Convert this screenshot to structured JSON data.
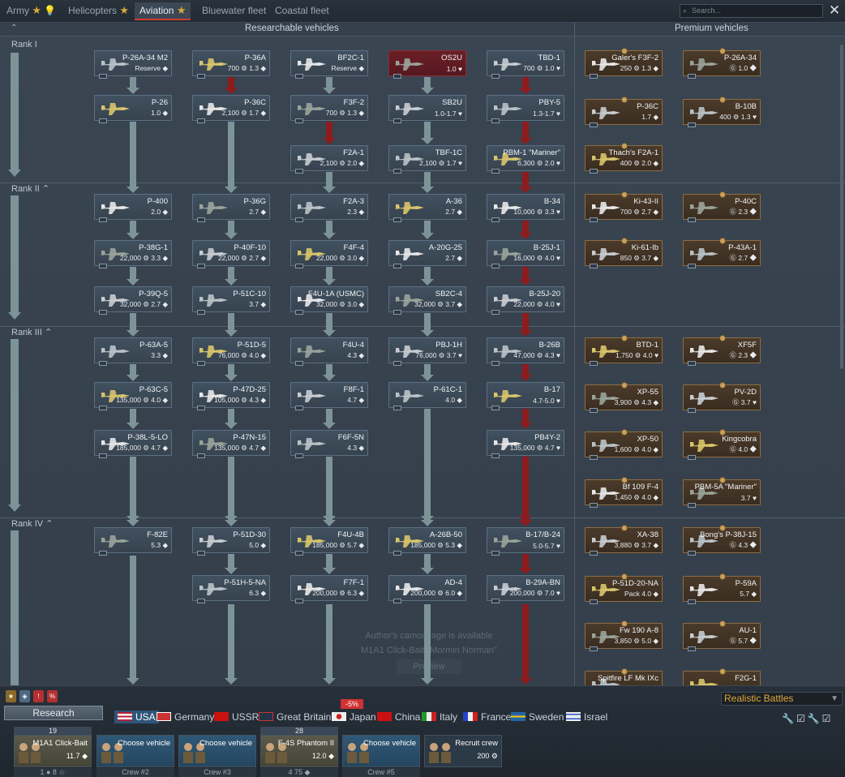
{
  "tabs": [
    {
      "label": "Army",
      "active": false
    },
    {
      "label": "Helicopters",
      "active": false
    },
    {
      "label": "Aviation",
      "active": true
    },
    {
      "label": "Bluewater fleet",
      "active": false
    },
    {
      "label": "Coastal fleet",
      "active": false
    }
  ],
  "search": {
    "placeholder": "Search..."
  },
  "headers": {
    "researchable": "Researchable vehicles",
    "premium": "Premium vehicles"
  },
  "ranks": [
    "Rank I",
    "Rank II",
    "Rank III",
    "Rank IV"
  ],
  "tree": {
    "col1": [
      {
        "name": "P-26A-34 M2",
        "info": "Reserve ◆"
      },
      {
        "name": "P-26",
        "info": "1.0 ◆"
      },
      {
        "name": "P-400",
        "info": "2.0 ◆"
      },
      {
        "name": "P-38G-1",
        "info": "22,000 ⚙ 3.3 ◆"
      },
      {
        "name": "P-39Q-5",
        "info": "32,000 ⚙ 2.7 ◆"
      },
      {
        "name": "P-63A-5",
        "info": "3.3 ◆"
      },
      {
        "name": "P-63C-5",
        "info": "135,000 ⚙ 4.0 ◆"
      },
      {
        "name": "P-38L-5-LO",
        "info": "185,000 ⚙ 4.7 ◆"
      },
      {
        "name": "F-82E",
        "info": "5.3 ◆"
      }
    ],
    "col2": [
      {
        "name": "P-36A",
        "info": "700 ⚙ 1.3 ◆"
      },
      {
        "name": "P-36C",
        "info": "2,100 ⚙ 1.7 ◆"
      },
      {
        "name": "P-36G",
        "info": "2.7 ◆"
      },
      {
        "name": "P-40F-10",
        "info": "22,000 ⚙ 2.7 ◆"
      },
      {
        "name": "P-51C-10",
        "info": "3.7 ◆"
      },
      {
        "name": "P-51D-5",
        "info": "76,000 ⚙ 4.0 ◆"
      },
      {
        "name": "P-47D-25",
        "info": "105,000 ⚙ 4.3 ◆"
      },
      {
        "name": "P-47N-15",
        "info": "135,000 ⚙ 4.7 ◆"
      },
      {
        "name": "P-51D-30",
        "info": "5.0 ◆"
      },
      {
        "name": "P-51H-5-NA",
        "info": "6.3 ◆"
      }
    ],
    "col3": [
      {
        "name": "BF2C-1",
        "info": "Reserve ◆"
      },
      {
        "name": "F3F-2",
        "info": "700 ⚙ 1.3 ◆"
      },
      {
        "name": "F2A-1",
        "info": "2,100 ⚙ 2.0 ◆"
      },
      {
        "name": "F2A-3",
        "info": "2.3 ◆"
      },
      {
        "name": "F4F-4",
        "info": "22,000 ⚙ 3.0 ◆"
      },
      {
        "name": "F4U-1A (USMC)",
        "info": "32,000 ⚙ 3.0 ◆"
      },
      {
        "name": "F4U-4",
        "info": "4.3 ◆"
      },
      {
        "name": "F8F-1",
        "info": "4.7 ◆"
      },
      {
        "name": "F6F-5N",
        "info": "4.3 ◆"
      },
      {
        "name": "F4U-4B",
        "info": "185,000 ⚙ 5.7 ◆"
      },
      {
        "name": "F7F-1",
        "info": "200,000 ⚙ 6.3 ◆"
      }
    ],
    "col4": [
      {
        "name": "OS2U",
        "info": "1.0 ♥"
      },
      {
        "name": "SB2U",
        "info": "1.0-1.7 ♥"
      },
      {
        "name": "TBF-1C",
        "info": "2,100 ⚙ 1.7 ♥"
      },
      {
        "name": "A-36",
        "info": "2.7 ◆"
      },
      {
        "name": "A-20G-25",
        "info": "2.7 ◆"
      },
      {
        "name": "SB2C-4",
        "info": "32,000 ⚙ 3.7 ◆"
      },
      {
        "name": "PBJ-1H",
        "info": "76,000 ⚙ 3.7 ♥"
      },
      {
        "name": "P-61C-1",
        "info": "4.0 ◆"
      },
      {
        "name": "A-26B-50",
        "info": "185,000 ⚙ 5.3 ◆"
      },
      {
        "name": "AD-4",
        "info": "200,000 ⚙ 6.0 ◆"
      }
    ],
    "col5": [
      {
        "name": "TBD-1",
        "info": "700 ⚙ 1.0 ♥"
      },
      {
        "name": "PBY-5",
        "info": "1.3-1.7 ♥"
      },
      {
        "name": "PBM-1 \"Mariner\"",
        "info": "6,300 ⚙ 2.0 ♥"
      },
      {
        "name": "B-34",
        "info": "10,000 ⚙ 3.3 ♥"
      },
      {
        "name": "B-25J-1",
        "info": "16,000 ⚙ 4.0 ♥"
      },
      {
        "name": "B-25J-20",
        "info": "22,000 ⚙ 4.0 ♥"
      },
      {
        "name": "B-26B",
        "info": "47,000 ⚙ 4.3 ♥"
      },
      {
        "name": "B-17",
        "info": "4.7-5.0 ♥"
      },
      {
        "name": "PB4Y-2",
        "info": "135,000 ⚙ 4.7 ♥"
      },
      {
        "name": "B-17/B-24",
        "info": "5.0-5.7 ♥"
      },
      {
        "name": "B-29A-BN",
        "info": "200,000 ⚙ 7.0 ♥"
      }
    ],
    "premium": [
      {
        "name": "Galer's F3F-2",
        "info": "250 ⚙ 1.3 ◆"
      },
      {
        "name": "P-26A-34",
        "info": "Ⓖ 1.0 ◆"
      },
      {
        "name": "P-36C",
        "info": "1.7 ◆"
      },
      {
        "name": "B-10B",
        "info": "400 ⚙ 1.3 ♥"
      },
      {
        "name": "Thach's F2A-1",
        "info": "400 ⚙ 2.0 ◆"
      },
      {
        "name": "Ki-43-II",
        "info": "700 ⚙ 2.7 ◆"
      },
      {
        "name": "P-40C",
        "info": "Ⓖ 2.3 ◆"
      },
      {
        "name": "Ki-61-Ib",
        "info": "850 ⚙ 3.7 ◆"
      },
      {
        "name": "P-43A-1",
        "info": "Ⓖ 2.7 ◆"
      },
      {
        "name": "BTD-1",
        "info": "1,750 ⚙ 4.0 ♥"
      },
      {
        "name": "XF5F",
        "info": "Ⓖ 2.3 ◆"
      },
      {
        "name": "XP-55",
        "info": "3,900 ⚙ 4.3 ◆"
      },
      {
        "name": "PV-2D",
        "info": "Ⓖ 3.7 ♥"
      },
      {
        "name": "XP-50",
        "info": "1,600 ⚙ 4.0 ◆"
      },
      {
        "name": "Kingcobra",
        "info": "Ⓖ 4.0 ◆"
      },
      {
        "name": "Bf 109 F-4",
        "info": "1,450 ⚙ 4.0 ◆"
      },
      {
        "name": "PBM-5A \"Mariner\"",
        "info": "3.7 ♥"
      },
      {
        "name": "XA-38",
        "info": "3,880 ⚙ 3.7 ◆"
      },
      {
        "name": "Bong's P-38J-15",
        "info": "Ⓖ 4.3 ◆"
      },
      {
        "name": "P-51D-20-NA",
        "info": "Pack 4.0 ◆"
      },
      {
        "name": "P-59A",
        "info": "5.7 ◆"
      },
      {
        "name": "Fw 190 A-8",
        "info": "3,850 ⚙ 5.0 ◆"
      },
      {
        "name": "AU-1",
        "info": "Ⓖ 5.7 ◆"
      },
      {
        "name": "Spitfire LF Mk IXc",
        "info": ""
      },
      {
        "name": "F2G-1",
        "info": ""
      }
    ]
  },
  "watermark": {
    "line1": "Author's camouflage is available",
    "line2": "M1A1 Click-Bait \"Mormin Norman\"",
    "preview": "Preview"
  },
  "bottom": {
    "research": "Research",
    "mode": "Realistic Battles",
    "discount": "-5%",
    "nations": [
      "USA",
      "Germany",
      "USSR",
      "Great Britain",
      "Japan",
      "China",
      "Italy",
      "France",
      "Sweden",
      "Israel"
    ],
    "crew": [
      {
        "name": "M1A1 Click-Bait",
        "value": "11.7 ◆",
        "top": "19",
        "footer": "1   ● 8 ☆"
      },
      {
        "name": "Choose vehicle",
        "value": "",
        "top": "",
        "footer": "Crew #2"
      },
      {
        "name": "Choose vehicle",
        "value": "",
        "top": "",
        "footer": "Crew #3"
      },
      {
        "name": "F-4S Phantom II",
        "value": "12.0 ◆",
        "top": "28",
        "footer": "4   75 ◆"
      },
      {
        "name": "Choose vehicle",
        "value": "",
        "top": "",
        "footer": "Crew #5"
      },
      {
        "name": "Recruit crew",
        "value": "200 ⚙",
        "top": "",
        "footer": ""
      }
    ]
  },
  "colors": {
    "accent": "#d23b2c",
    "premium_border": "#8e6d40",
    "tree_line": "#7c9497",
    "red_line": "#8c1c1e"
  }
}
